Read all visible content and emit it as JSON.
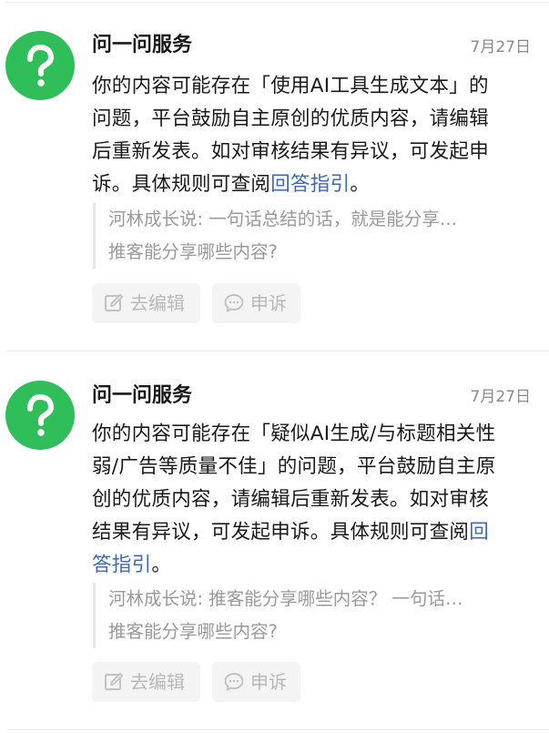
{
  "messages": [
    {
      "sender": "问一问服务",
      "date": "7月27日",
      "body_lines": [
        "你的内容可能存在「使用AI工具生成文本」的",
        "问题，平台鼓励自主原创的优质内容，请编辑",
        "后重新发表。如对审核结果有异议，可发起申",
        "诉。具体规则可查阅"
      ],
      "link_text": "回答指引",
      "body_end": "。",
      "quote_line1": "河林成长说: 一句话总结的话，就是能分享…",
      "quote_line2": "推客能分享哪些内容?",
      "edit_label": "去编辑",
      "appeal_label": "申诉"
    },
    {
      "sender": "问一问服务",
      "date": "7月27日",
      "body_lines": [
        "你的内容可能存在「疑似AI生成/与标题相关性",
        "弱/广告等质量不佳」的问题，平台鼓励自主原",
        "创的优质内容，请编辑后重新发表。如对审核",
        "结果有异议，可发起申诉。具体规则可查阅"
      ],
      "link_text_part1": "回",
      "link_text_part2": "答指引",
      "body_end": "。",
      "quote_line1": "河林成长说: 推客能分享哪些内容？ 一句话…",
      "quote_line2": "推客能分享哪些内容?",
      "edit_label": "去编辑",
      "appeal_label": "申诉"
    }
  ],
  "icons": {
    "avatar": "question-mark-icon",
    "edit": "edit-icon",
    "appeal": "chat-bubble-icon"
  },
  "colors": {
    "avatar_green": "#2fbe5a",
    "link_blue": "#3d69b4",
    "button_bg": "#f4f4f4",
    "button_text": "#b8b8b8"
  }
}
